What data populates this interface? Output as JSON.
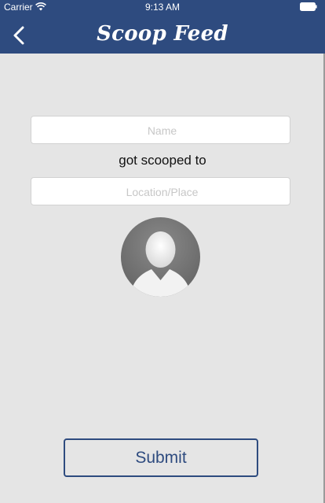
{
  "status_bar": {
    "carrier": "Carrier",
    "time": "9:13 AM",
    "wifi_icon": "wifi-icon",
    "battery_icon": "battery-icon"
  },
  "nav": {
    "title": "Scoop Feed",
    "back_icon": "chevron-left-icon",
    "background_color": "#2e4b7f"
  },
  "form": {
    "name_placeholder": "Name",
    "name_value": "",
    "connector_text": "got scooped to",
    "location_placeholder": "Location/Place",
    "location_value": "",
    "avatar_icon": "user-avatar-placeholder-icon",
    "submit_label": "Submit"
  },
  "colors": {
    "accent": "#2e4b7f",
    "background": "#e5e5e5"
  }
}
